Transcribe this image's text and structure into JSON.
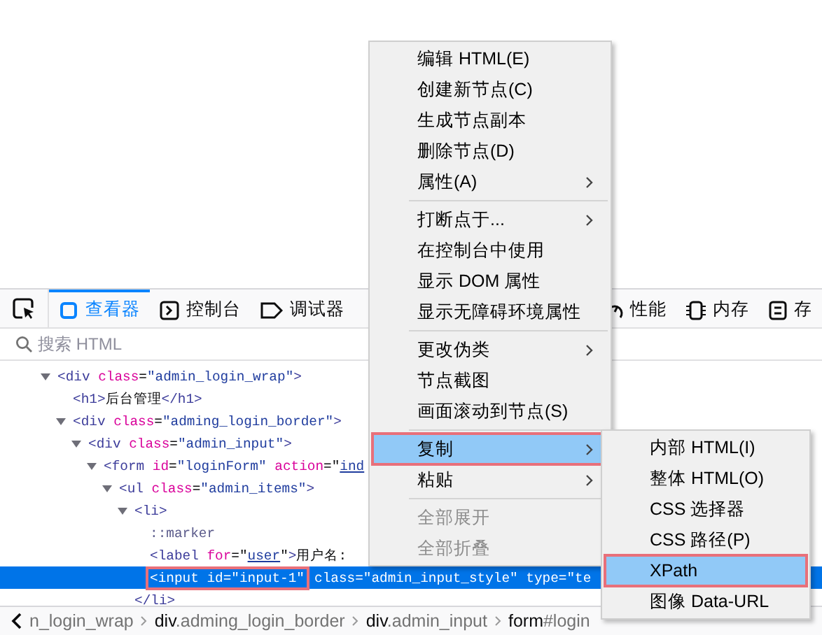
{
  "toolbar": {
    "tabs": [
      {
        "label": "查看器",
        "selected": true
      },
      {
        "label": "控制台",
        "selected": false
      },
      {
        "label": "调试器",
        "selected": false
      }
    ],
    "tabs_right": [
      {
        "label": "性能",
        "selected": false
      },
      {
        "label": "内存",
        "selected": false
      },
      {
        "label": "存",
        "selected": false
      }
    ]
  },
  "search": {
    "placeholder": "搜索 HTML"
  },
  "tree": [
    {
      "expanded": true,
      "selected": false,
      "highlighted": false,
      "tokens": [
        {
          "kind": "tag",
          "text": "<div"
        },
        {
          "kind": "attr",
          "text": " class"
        },
        {
          "kind": "text",
          "text": "="
        },
        {
          "kind": "value",
          "text": "\"admin_login_wrap\""
        },
        {
          "kind": "tag",
          "text": ">"
        }
      ],
      "children": [
        {
          "selected": false,
          "highlighted": false,
          "tokens": [
            {
              "kind": "tag",
              "text": "<h1>"
            },
            {
              "kind": "text",
              "text": "后台管理"
            },
            {
              "kind": "tag",
              "text": "</h1>"
            }
          ]
        },
        {
          "expanded": true,
          "selected": false,
          "highlighted": false,
          "tokens": [
            {
              "kind": "tag",
              "text": "<div"
            },
            {
              "kind": "attr",
              "text": " class"
            },
            {
              "kind": "text",
              "text": "="
            },
            {
              "kind": "value",
              "text": "\"adming_login_border\""
            },
            {
              "kind": "tag",
              "text": ">"
            }
          ],
          "children": [
            {
              "expanded": true,
              "selected": false,
              "highlighted": false,
              "tokens": [
                {
                  "kind": "tag",
                  "text": "<div"
                },
                {
                  "kind": "attr",
                  "text": " class"
                },
                {
                  "kind": "text",
                  "text": "="
                },
                {
                  "kind": "value",
                  "text": "\"admin_input\""
                },
                {
                  "kind": "tag",
                  "text": ">"
                }
              ],
              "children": [
                {
                  "expanded": true,
                  "selected": false,
                  "highlighted": false,
                  "tokens": [
                    {
                      "kind": "tag",
                      "text": "<form"
                    },
                    {
                      "kind": "attr",
                      "text": " id"
                    },
                    {
                      "kind": "text",
                      "text": "="
                    },
                    {
                      "kind": "value",
                      "text": "\"loginForm\""
                    },
                    {
                      "kind": "attr",
                      "text": " action"
                    },
                    {
                      "kind": "text",
                      "text": "=\""
                    },
                    {
                      "kind": "link",
                      "text": "ind"
                    }
                  ],
                  "children": [
                    {
                      "expanded": true,
                      "selected": false,
                      "highlighted": false,
                      "tokens": [
                        {
                          "kind": "tag",
                          "text": "<ul"
                        },
                        {
                          "kind": "attr",
                          "text": " class"
                        },
                        {
                          "kind": "text",
                          "text": "="
                        },
                        {
                          "kind": "value",
                          "text": "\"admin_items\""
                        },
                        {
                          "kind": "tag",
                          "text": ">"
                        }
                      ],
                      "children": [
                        {
                          "expanded": true,
                          "selected": false,
                          "highlighted": false,
                          "close": "</li>",
                          "tokens": [
                            {
                              "kind": "tag",
                              "text": "<li>"
                            }
                          ],
                          "children": [
                            {
                              "selected": false,
                              "highlighted": false,
                              "tokens": [
                                {
                                  "kind": "pseudo",
                                  "text": "::marker"
                                }
                              ]
                            },
                            {
                              "selected": false,
                              "highlighted": false,
                              "tokens": [
                                {
                                  "kind": "tag",
                                  "text": "<label"
                                },
                                {
                                  "kind": "attr",
                                  "text": " for"
                                },
                                {
                                  "kind": "text",
                                  "text": "=\""
                                },
                                {
                                  "kind": "link",
                                  "text": "user"
                                },
                                {
                                  "kind": "text",
                                  "text": "\""
                                },
                                {
                                  "kind": "tag",
                                  "text": ">"
                                },
                                {
                                  "kind": "text",
                                  "text": "用户名:"
                                }
                              ]
                            },
                            {
                              "selected": true,
                              "highlighted": true,
                              "tokens": [
                                {
                                  "kind": "tag",
                                  "text": "<input"
                                },
                                {
                                  "kind": "attr",
                                  "text": " id"
                                },
                                {
                                  "kind": "text",
                                  "text": "="
                                },
                                {
                                  "kind": "value",
                                  "text": "\"input-1\""
                                }
                              ],
                              "rest": "class=\"admin_input_style\" type=\"te"
                            }
                          ]
                        }
                      ]
                    }
                  ]
                }
              ]
            }
          ]
        }
      ]
    }
  ],
  "breadcrumbs": [
    {
      "rest": "n_login_wrap"
    },
    {
      "tag": "div",
      "rest": ".adming_login_border"
    },
    {
      "tag": "div",
      "rest": ".admin_input"
    },
    {
      "tag": "form",
      "rest": "#login"
    }
  ],
  "context_menu": [
    {
      "kind": "item",
      "label": "编辑 HTML(E)",
      "submenu": false,
      "disabled": false,
      "selected": false,
      "highlighted": false
    },
    {
      "kind": "item",
      "label": "创建新节点(C)",
      "submenu": false,
      "disabled": false,
      "selected": false,
      "highlighted": false
    },
    {
      "kind": "item",
      "label": "生成节点副本",
      "submenu": false,
      "disabled": false,
      "selected": false,
      "highlighted": false
    },
    {
      "kind": "item",
      "label": "删除节点(D)",
      "submenu": false,
      "disabled": false,
      "selected": false,
      "highlighted": false
    },
    {
      "kind": "item",
      "label": "属性(A)",
      "submenu": true,
      "disabled": false,
      "selected": false,
      "highlighted": false
    },
    {
      "kind": "separator"
    },
    {
      "kind": "item",
      "label": "打断点于...",
      "submenu": true,
      "disabled": false,
      "selected": false,
      "highlighted": false
    },
    {
      "kind": "item",
      "label": "在控制台中使用",
      "submenu": false,
      "disabled": false,
      "selected": false,
      "highlighted": false
    },
    {
      "kind": "item",
      "label": "显示 DOM 属性",
      "submenu": false,
      "disabled": false,
      "selected": false,
      "highlighted": false
    },
    {
      "kind": "item",
      "label": "显示无障碍环境属性",
      "submenu": false,
      "disabled": false,
      "selected": false,
      "highlighted": false
    },
    {
      "kind": "separator"
    },
    {
      "kind": "item",
      "label": "更改伪类",
      "submenu": true,
      "disabled": false,
      "selected": false,
      "highlighted": false
    },
    {
      "kind": "item",
      "label": "节点截图",
      "submenu": false,
      "disabled": false,
      "selected": false,
      "highlighted": false
    },
    {
      "kind": "item",
      "label": "画面滚动到节点(S)",
      "submenu": false,
      "disabled": false,
      "selected": false,
      "highlighted": false
    },
    {
      "kind": "separator"
    },
    {
      "kind": "item",
      "label": "复制",
      "submenu": true,
      "disabled": false,
      "selected": true,
      "highlighted": true,
      "items": [
        {
          "label": "内部 HTML(I)",
          "disabled": false,
          "selected": false,
          "highlighted": false
        },
        {
          "label": "整体 HTML(O)",
          "disabled": false,
          "selected": false,
          "highlighted": false
        },
        {
          "label": "CSS 选择器",
          "disabled": false,
          "selected": false,
          "highlighted": false
        },
        {
          "label": "CSS 路径(P)",
          "disabled": false,
          "selected": false,
          "highlighted": false
        },
        {
          "label": "XPath",
          "disabled": false,
          "selected": true,
          "highlighted": true
        },
        {
          "label": "图像 Data-URL",
          "disabled": false,
          "selected": false,
          "highlighted": false
        }
      ]
    },
    {
      "kind": "item",
      "label": "粘贴",
      "submenu": true,
      "disabled": false,
      "selected": false,
      "highlighted": false
    },
    {
      "kind": "separator"
    },
    {
      "kind": "item",
      "label": "全部展开",
      "submenu": false,
      "disabled": true,
      "selected": false,
      "highlighted": false
    },
    {
      "kind": "item",
      "label": "全部折叠",
      "submenu": false,
      "disabled": true,
      "selected": false,
      "highlighted": false
    }
  ]
}
